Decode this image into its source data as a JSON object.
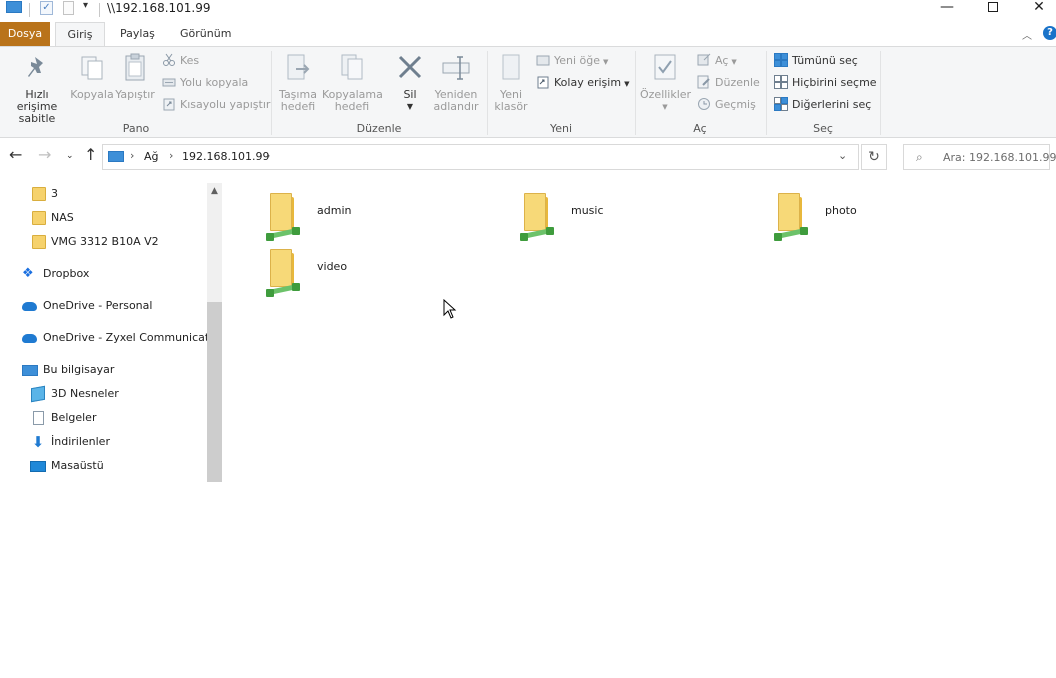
{
  "titlebar": {
    "title": "\\\\192.168.101.99",
    "min_label": "—",
    "close_label": "✕"
  },
  "tabs": {
    "file": "Dosya",
    "home": "Giriş",
    "share": "Paylaş",
    "view": "Görünüm"
  },
  "ribbon": {
    "pano": {
      "label": "Pano",
      "pin": "Hızlı erişime sabitle",
      "pin_line1": "Hızlı erişime",
      "pin_line2": "sabitle",
      "copy": "Kopyala",
      "paste": "Yapıştır",
      "cut": "Kes",
      "copy_path": "Yolu kopyala",
      "paste_shortcut": "Kısayolu yapıştır"
    },
    "duzenle": {
      "label": "Düzenle",
      "move_line1": "Taşıma",
      "move_line2": "hedefi",
      "copyto_line1": "Kopyalama",
      "copyto_line2": "hedefi",
      "delete": "Sil",
      "rename_line1": "Yeniden",
      "rename_line2": "adlandır"
    },
    "yeni": {
      "label": "Yeni",
      "new_folder_line1": "Yeni",
      "new_folder_line2": "klasör",
      "new_item": "Yeni öğe",
      "easy_access": "Kolay erişim"
    },
    "ac": {
      "label": "Aç",
      "properties": "Özellikler",
      "open": "Aç",
      "edit": "Düzenle",
      "history": "Geçmiş"
    },
    "sec": {
      "label": "Seç",
      "select_all": "Tümünü seç",
      "select_none": "Hiçbirini seçme",
      "invert": "Diğerlerini seç"
    }
  },
  "address": {
    "segments": [
      "Ağ",
      "192.168.101.99"
    ],
    "search_placeholder": "Ara: 192.168.101.99"
  },
  "navpane": {
    "items": [
      {
        "label": "3",
        "icon": "folder-icon"
      },
      {
        "label": "NAS",
        "icon": "folder-icon"
      },
      {
        "label": "VMG 3312 B10A V2",
        "icon": "folder-icon"
      },
      {
        "label": "Dropbox",
        "icon": "dropbox-icon"
      },
      {
        "label": "OneDrive - Personal",
        "icon": "onedrive-icon"
      },
      {
        "label": "OneDrive - Zyxel Communications",
        "icon": "onedrive-icon"
      },
      {
        "label": "Bu bilgisayar",
        "icon": "computer-icon"
      },
      {
        "label": "3D Nesneler",
        "icon": "3d-objects-icon"
      },
      {
        "label": "Belgeler",
        "icon": "documents-icon"
      },
      {
        "label": "İndirilenler",
        "icon": "downloads-icon"
      },
      {
        "label": "Masaüstü",
        "icon": "desktop-icon"
      }
    ]
  },
  "content": {
    "folders": [
      {
        "name": "admin",
        "icon": "network-share-folder-icon"
      },
      {
        "name": "music",
        "icon": "network-share-folder-icon"
      },
      {
        "name": "photo",
        "icon": "network-share-folder-icon"
      },
      {
        "name": "video",
        "icon": "network-share-folder-icon"
      }
    ]
  },
  "colors": {
    "file_tab": "#b9731a",
    "ribbon_bg": "#f5f6f7",
    "folder_yellow": "#f7d978",
    "share_green": "#6cc26a",
    "accent_blue": "#1a73c9"
  }
}
